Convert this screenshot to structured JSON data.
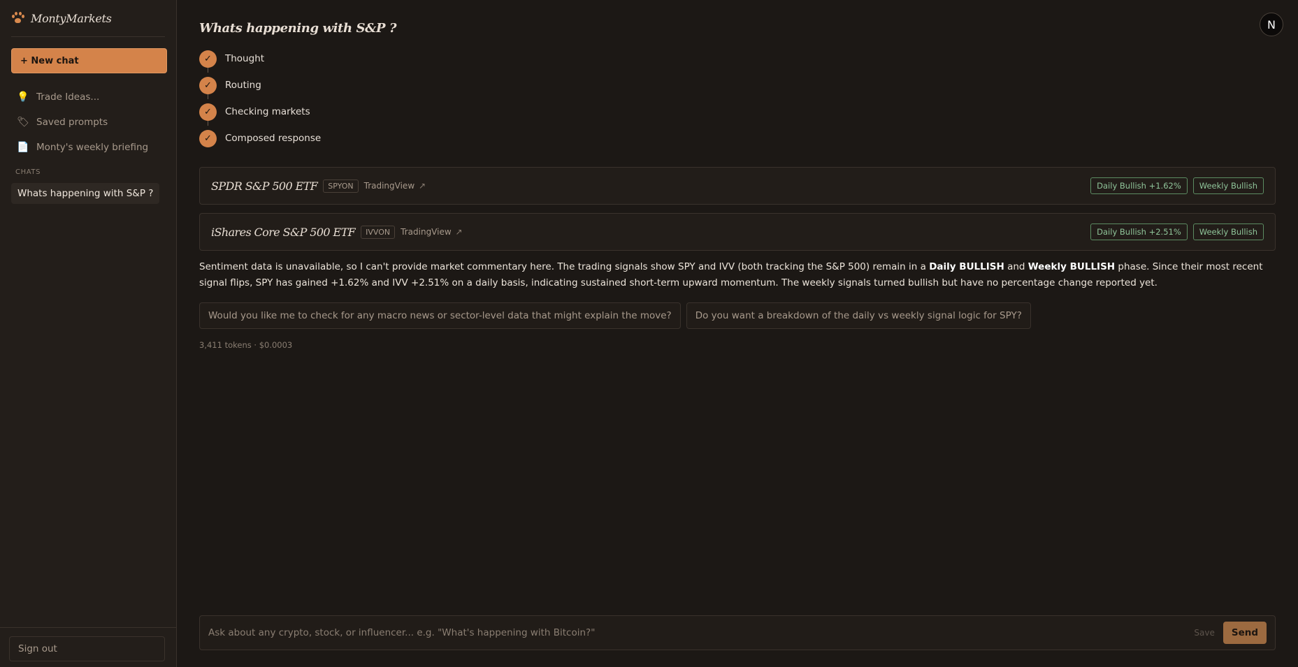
{
  "app": {
    "brand": "MontyMarkets",
    "accent_color": "#d4834a"
  },
  "sidebar": {
    "new_chat_label": "+ New chat",
    "nav_items": [
      {
        "label": "Trade Ideas...",
        "icon": "lightbulb-icon",
        "glyph": "💡"
      },
      {
        "label": "Saved prompts",
        "icon": "tag-icon",
        "glyph": "🏷"
      },
      {
        "label": "Monty's weekly briefing",
        "icon": "document-icon",
        "glyph": "📄"
      }
    ],
    "chats_label": "CHATS",
    "chats": [
      {
        "label": "Whats happening with S&P ?"
      }
    ],
    "signout_label": "Sign out"
  },
  "header": {
    "avatar_initial": "N"
  },
  "conversation": {
    "title": "Whats happening with S&P ?",
    "steps": [
      {
        "label": "Thought",
        "status": "done"
      },
      {
        "label": "Routing",
        "status": "done"
      },
      {
        "label": "Checking markets",
        "status": "done"
      },
      {
        "label": "Composed response",
        "status": "done"
      }
    ],
    "cards": [
      {
        "name": "SPDR S&P 500 ETF",
        "ticker": "SPYON",
        "link_label": "TradingView",
        "daily_badge": "Daily Bullish +1.62%",
        "weekly_badge": "Weekly Bullish"
      },
      {
        "name": "iShares Core S&P 500 ETF",
        "ticker": "IVVON",
        "link_label": "TradingView",
        "daily_badge": "Daily Bullish +2.51%",
        "weekly_badge": "Weekly Bullish"
      }
    ],
    "response": {
      "part1": "Sentiment data is unavailable, so I can't provide market commentary here. The trading signals show SPY and IVV (both tracking the S&P 500) remain in a ",
      "bold1": "Daily BULLISH",
      "part2": " and ",
      "bold2": "Weekly BULLISH",
      "part3": " phase. Since their most recent signal flips, SPY has gained +1.62% and IVV +2.51% on a daily basis, indicating sustained short-term upward momentum. The weekly signals turned bullish but have no percentage change reported yet."
    },
    "followups": [
      "Would you like me to check for any macro news or sector-level data that might explain the move?",
      "Do you want a breakdown of the daily vs weekly signal logic for SPY?"
    ],
    "usage": "3,411 tokens · $0.0003"
  },
  "composer": {
    "placeholder": "Ask about any crypto, stock, or influencer... e.g. \"What's happening with Bitcoin?\"",
    "value": "",
    "save_label": "Save",
    "send_label": "Send"
  }
}
